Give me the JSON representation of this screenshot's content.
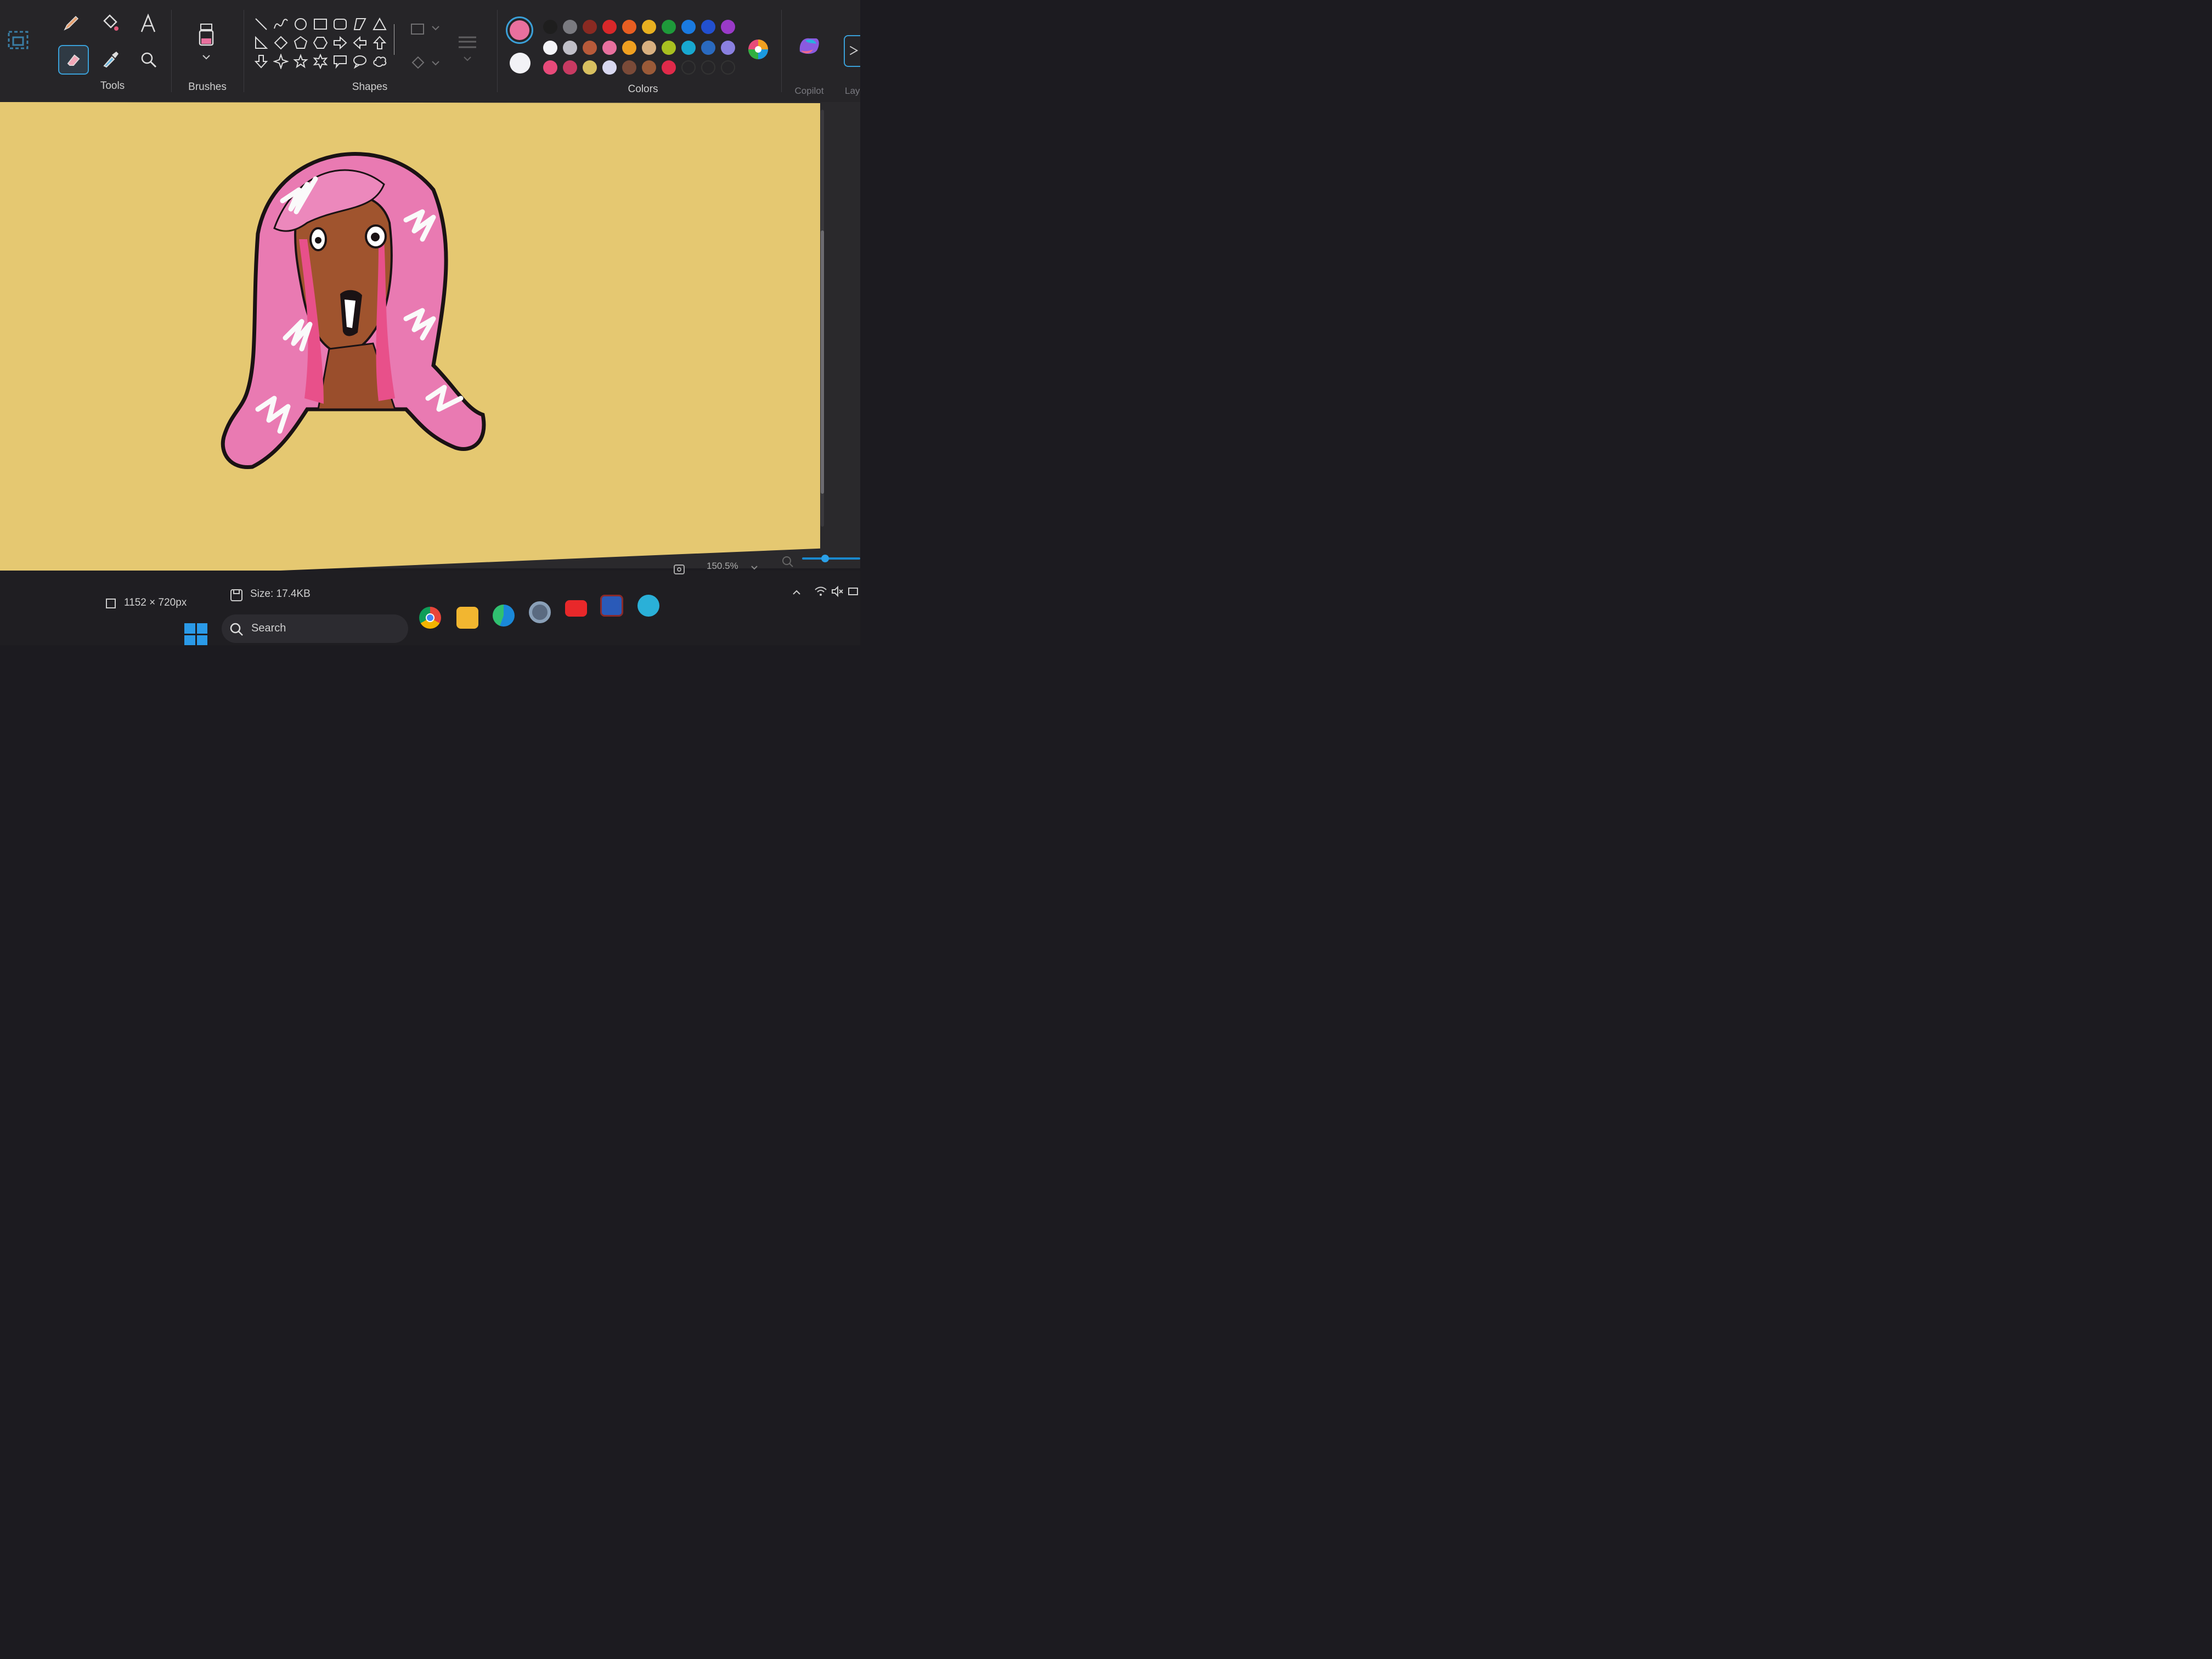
{
  "ribbon": {
    "groups": {
      "tools": "Tools",
      "brushes": "Brushes",
      "shapes": "Shapes",
      "colors": "Colors",
      "copilot": "Copilot",
      "layers": "Lay"
    }
  },
  "colors": {
    "primary": "#e8709e",
    "secondary": "#f2f2f6",
    "palette_row1": [
      "#1e1e1e",
      "#7a7a80",
      "#8a2a22",
      "#d8282a",
      "#e85e22",
      "#e8b020",
      "#1e9a3a",
      "#1a7ae0",
      "#2250d0",
      "#9a3ac8"
    ],
    "palette_row2": [
      "#f4f4f8",
      "#c0bfc8",
      "#b85a3a",
      "#e8709e",
      "#f0a020",
      "#d8b080",
      "#a8c020",
      "#18a8d0",
      "#2a6ac0",
      "#8a80e0"
    ],
    "palette_row3": [
      "#e84a7a",
      "#c83a62",
      "#d8c060",
      "#d8d8f0",
      "#7a4a38",
      "#9a5a38",
      "#e02a4a"
    ]
  },
  "status": {
    "dimensions": "1152 × 720px",
    "size": "Size: 17.4KB",
    "zoom": "150.5%"
  },
  "taskbar": {
    "search_placeholder": "Search",
    "apps": [
      "windows-start",
      "chrome",
      "file-explorer",
      "edge",
      "settings",
      "youtube",
      "word",
      "globe-app"
    ]
  }
}
